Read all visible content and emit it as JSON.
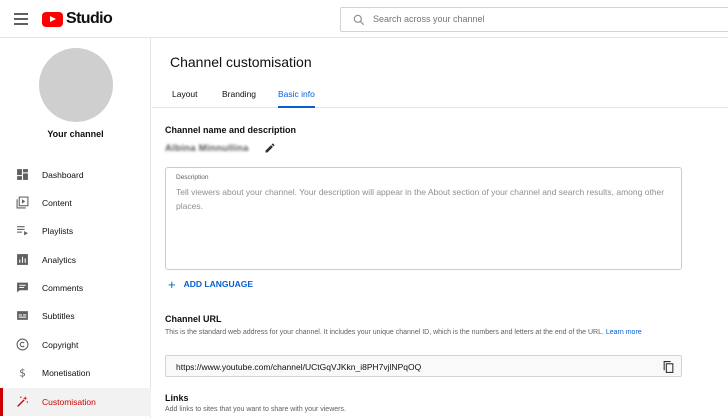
{
  "header": {
    "logo_text": "Studio",
    "search_placeholder": "Search across your channel"
  },
  "sidebar": {
    "channel_label": "Your channel",
    "items": [
      {
        "label": "Dashboard",
        "icon": "dashboard-icon"
      },
      {
        "label": "Content",
        "icon": "content-icon"
      },
      {
        "label": "Playlists",
        "icon": "playlists-icon"
      },
      {
        "label": "Analytics",
        "icon": "analytics-icon"
      },
      {
        "label": "Comments",
        "icon": "comments-icon"
      },
      {
        "label": "Subtitles",
        "icon": "subtitles-icon"
      },
      {
        "label": "Copyright",
        "icon": "copyright-icon"
      },
      {
        "label": "Monetisation",
        "icon": "monetisation-icon"
      },
      {
        "label": "Customisation",
        "icon": "customisation-icon",
        "active": true
      }
    ]
  },
  "main": {
    "title": "Channel customisation",
    "tabs": [
      {
        "label": "Layout"
      },
      {
        "label": "Branding"
      },
      {
        "label": "Basic info",
        "active": true
      }
    ],
    "name_section": {
      "title": "Channel name and description",
      "channel_name": "Albina Minnullina"
    },
    "description": {
      "label": "Description",
      "placeholder": "Tell viewers about your channel. Your description will appear in the About section of your channel and search results, among other places."
    },
    "add_language": "ADD LANGUAGE",
    "channel_url": {
      "title": "Channel URL",
      "help": "This is the standard web address for your channel. It includes your unique channel ID, which is the numbers and letters at the end of the URL.",
      "learn_more": "Learn more",
      "value": "https://www.youtube.com/channel/UCtGqVJKkn_i8PH7vjlNPqOQ"
    },
    "links": {
      "title": "Links",
      "help": "Add links to sites that you want to share with your viewers."
    }
  },
  "colors": {
    "accent_blue": "#065fd4",
    "active_red": "#cc0000",
    "brand_red": "#ff0000"
  }
}
